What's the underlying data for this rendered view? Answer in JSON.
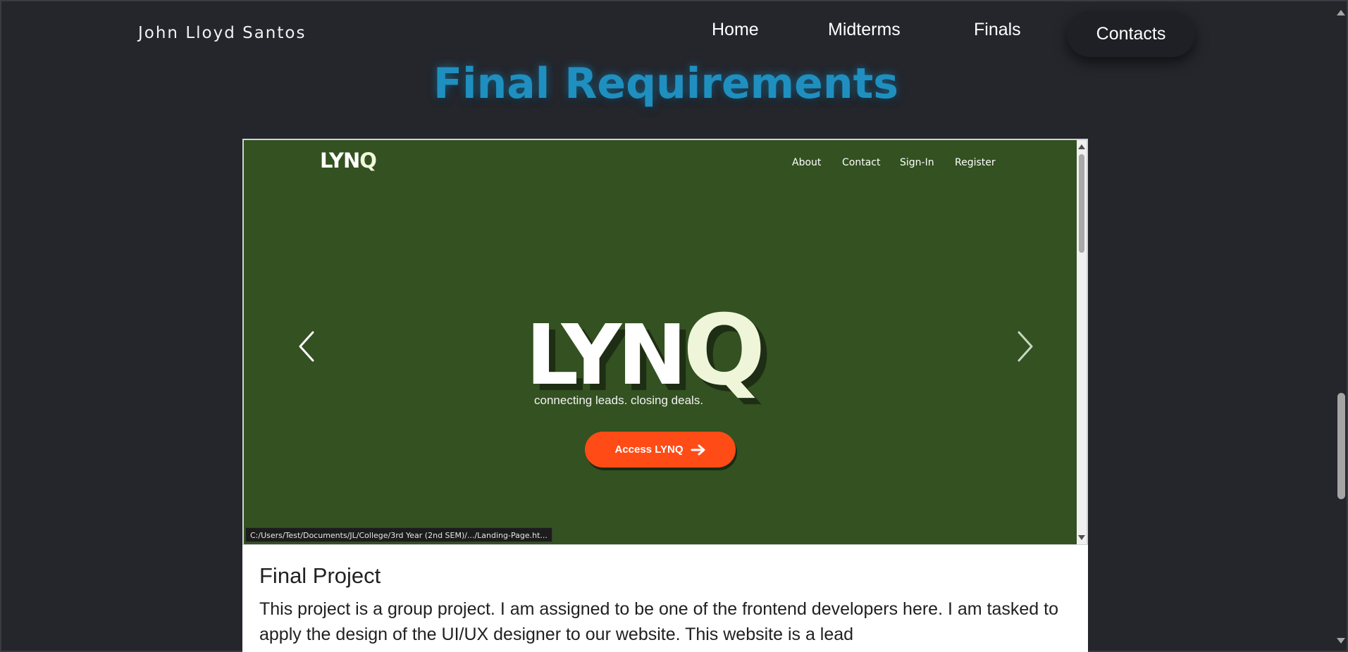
{
  "header": {
    "brand": "John Lloyd Santos",
    "nav": {
      "home": "Home",
      "midterms": "Midterms",
      "finals": "Finals",
      "contacts": "Contacts"
    }
  },
  "main": {
    "title": "Final Requirements",
    "card": {
      "preview": {
        "logo": "LYN",
        "logo_q": "Q",
        "nav": {
          "about": "About",
          "contact": "Contact",
          "sign_in": "Sign-In",
          "register": "Register"
        },
        "hero_logo": "LYN",
        "hero_logo_q": "Q",
        "tagline": "connecting leads. closing deals.",
        "cta_label": "Access LYNQ",
        "status_url": "C:/Users/Test/Documents/JL/College/3rd Year (2nd SEM)/.../Landing-Page.ht...",
        "prev_icon": "chevron-left-icon",
        "next_icon": "chevron-right-icon",
        "cta_icon": "arrow-right-icon",
        "colors": {
          "background": "#335121",
          "accent": "#ff4c17",
          "logo_q": "#eef5d8"
        }
      },
      "title": "Final Project",
      "description": "This project is a group project. I am assigned to be one of the frontend developers here. I am tasked to apply the design of the UI/UX designer to our website. This website is a lead"
    }
  },
  "colors": {
    "page_background": "#24262c",
    "title_accent": "#1f8fc0",
    "contacts_pill": "#1e2025"
  }
}
